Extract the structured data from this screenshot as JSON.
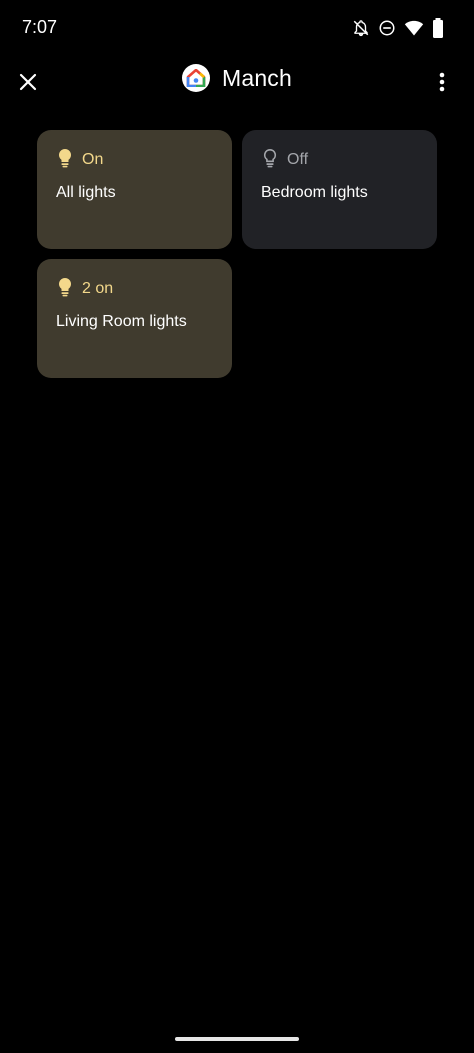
{
  "status_bar": {
    "time": "7:07",
    "icons": [
      "notifications-off-icon",
      "do-not-disturb-icon",
      "wifi-icon",
      "battery-icon"
    ]
  },
  "app_bar": {
    "title": "Manch",
    "close_icon": "close-icon",
    "menu_icon": "more-vert-icon",
    "logo_icon": "google-home-icon"
  },
  "tiles": [
    {
      "status": "On",
      "name": "All lights",
      "state": "on",
      "icon": "lightbulb-icon"
    },
    {
      "status": "Off",
      "name": "Bedroom lights",
      "state": "off",
      "icon": "lightbulb-outline-icon"
    },
    {
      "status": "2 on",
      "name": "Living Room lights",
      "state": "on",
      "icon": "lightbulb-icon"
    }
  ],
  "colors": {
    "background": "#000000",
    "tile_on": "#403b2e",
    "tile_off": "#212226",
    "on_accent": "#f3d88b",
    "off_text": "#a4a6ab"
  }
}
